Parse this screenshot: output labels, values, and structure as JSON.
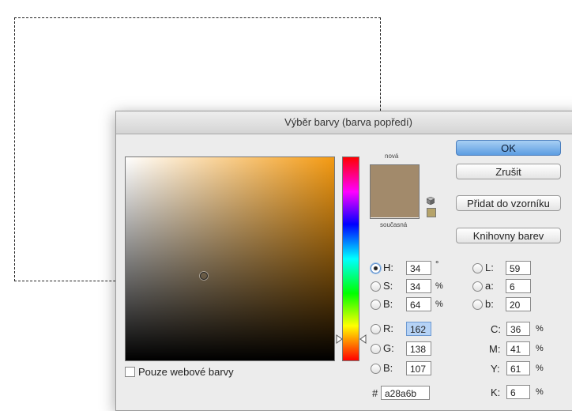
{
  "dialog": {
    "title": "Výběr barvy (barva popředí)",
    "new_label": "nová",
    "current_label": "současná",
    "new_color": "#a28a6b",
    "current_color": "#a28a6b",
    "mini_swatch_color": "#b5a36a"
  },
  "buttons": {
    "ok": "OK",
    "cancel": "Zrušit",
    "add_swatch": "Přidat do vzorníku",
    "libraries": "Knihovny barev"
  },
  "hsb": [
    {
      "label": "H:",
      "value": "34",
      "unit": "°",
      "selected": true
    },
    {
      "label": "S:",
      "value": "34",
      "unit": "%",
      "selected": false
    },
    {
      "label": "B:",
      "value": "64",
      "unit": "%",
      "selected": false
    }
  ],
  "rgb": [
    {
      "label": "R:",
      "value": "162"
    },
    {
      "label": "G:",
      "value": "138"
    },
    {
      "label": "B:",
      "value": "107"
    }
  ],
  "lab": [
    {
      "label": "L:",
      "value": "59"
    },
    {
      "label": "a:",
      "value": "6"
    },
    {
      "label": "b:",
      "value": "20"
    }
  ],
  "cmyk": [
    {
      "label": "C:",
      "value": "36",
      "unit": "%"
    },
    {
      "label": "M:",
      "value": "41",
      "unit": "%"
    },
    {
      "label": "Y:",
      "value": "61",
      "unit": "%"
    },
    {
      "label": "K:",
      "value": "6",
      "unit": "%"
    }
  ],
  "hex": {
    "prefix": "#",
    "value": "a28a6b"
  },
  "web_only_label": "Pouze webové barvy",
  "icons": {
    "cube": "cube-icon",
    "picker": "color-picker-circle-icon"
  }
}
